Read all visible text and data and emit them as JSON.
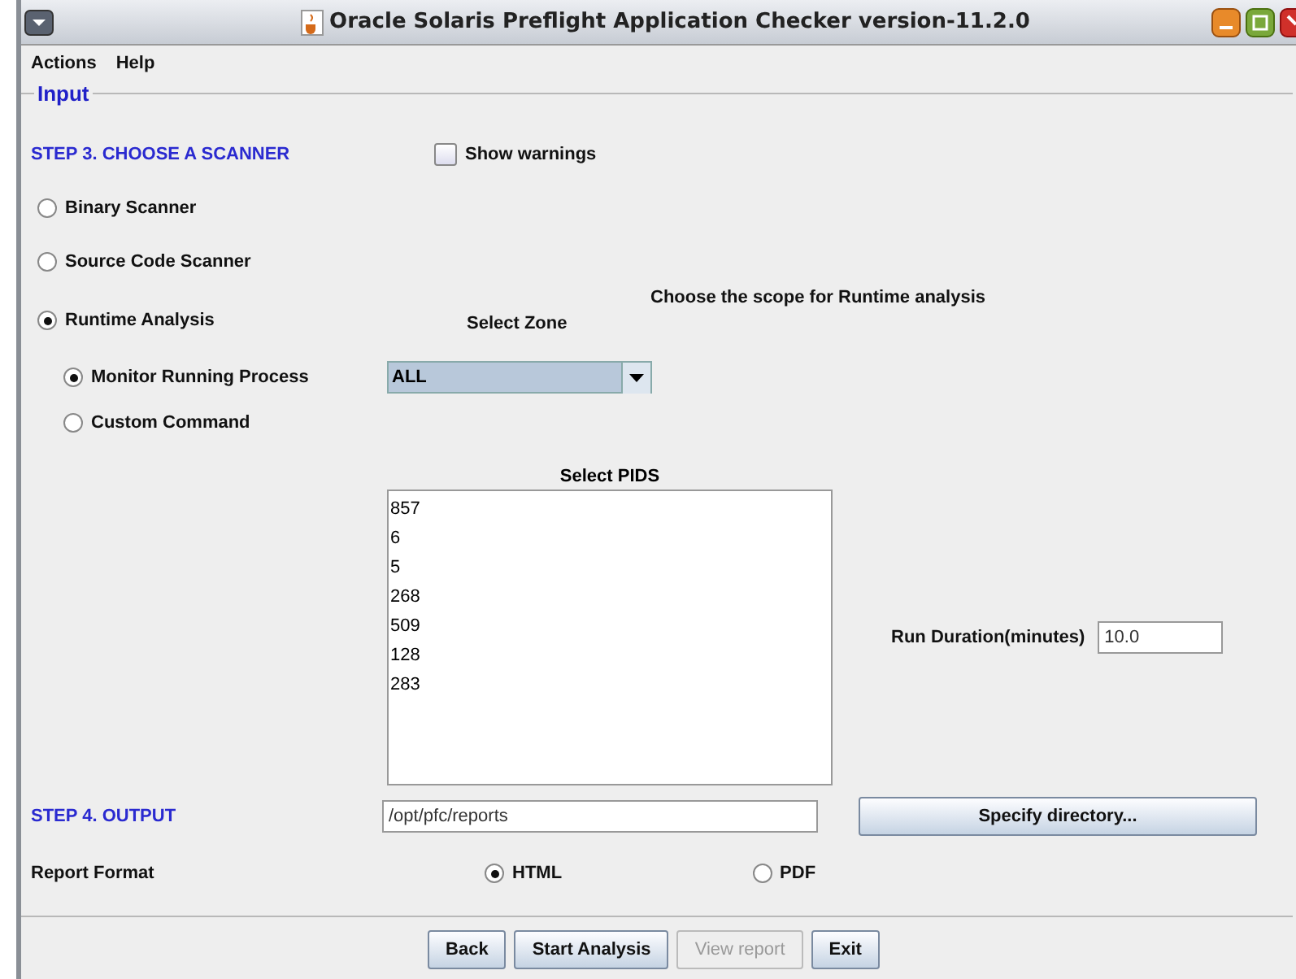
{
  "window": {
    "title": "Oracle Solaris Preflight Application Checker version-11.2.0"
  },
  "menu": [
    {
      "label": "Actions"
    },
    {
      "label": "Help"
    }
  ],
  "panel_title": "Input",
  "step3": {
    "label": "STEP 3. CHOOSE A SCANNER",
    "show_warnings": {
      "label": "Show warnings",
      "checked": false
    }
  },
  "scanners": [
    {
      "label": "Binary Scanner",
      "selected": false
    },
    {
      "label": "Source Code Scanner",
      "selected": false
    },
    {
      "label": "Runtime Analysis",
      "selected": true
    }
  ],
  "runtime": {
    "scope_label": "Choose the scope for Runtime analysis",
    "zone_label": "Select Zone",
    "zone": "ALL",
    "modes": [
      {
        "label": "Monitor Running Process",
        "selected": true
      },
      {
        "label": "Custom Command",
        "selected": false
      }
    ],
    "pids_label": "Select PIDS",
    "pids": [
      "857",
      "6",
      "5",
      "268",
      "509",
      "128",
      "283"
    ],
    "duration_label": "Run Duration(minutes)",
    "duration": "10.0"
  },
  "step4": {
    "label": "STEP 4. OUTPUT",
    "directory": "/opt/pfc/reports",
    "specify_button": "Specify directory..."
  },
  "report_format": {
    "label": "Report Format",
    "options": [
      {
        "label": "HTML",
        "selected": true
      },
      {
        "label": "PDF",
        "selected": false
      }
    ]
  },
  "buttons": [
    {
      "label": "Back",
      "disabled": false
    },
    {
      "label": "Start Analysis",
      "disabled": false
    },
    {
      "label": "View report",
      "disabled": true
    },
    {
      "label": "Exit",
      "disabled": false
    }
  ]
}
